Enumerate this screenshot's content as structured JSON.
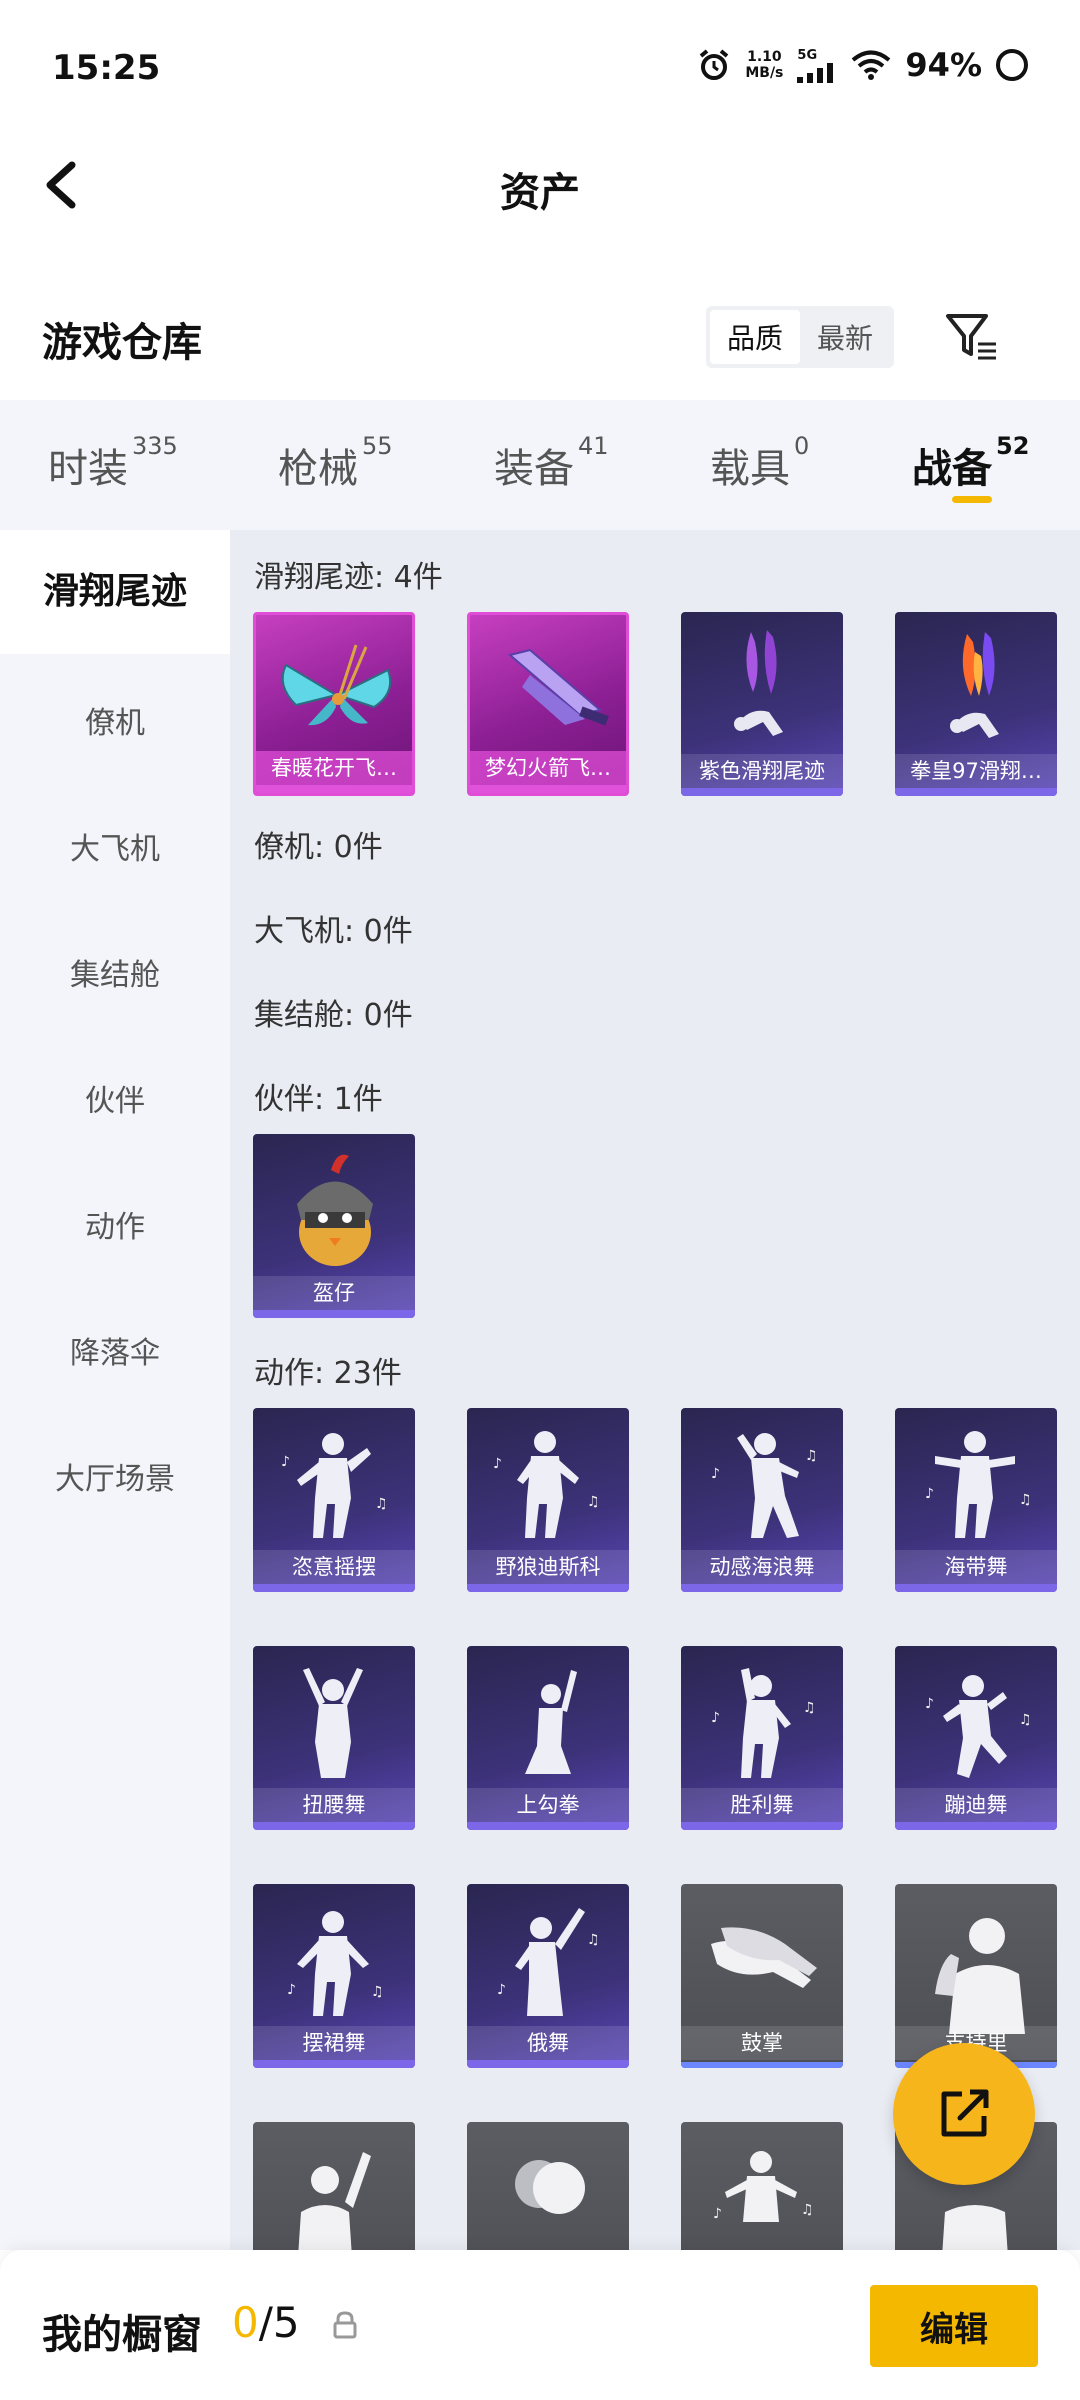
{
  "status_bar": {
    "time": "15:25",
    "net_speed_value": "1.10",
    "net_speed_unit": "MB/s",
    "network": "5G",
    "battery": "94%",
    "icons": [
      "alarm-icon",
      "signal-icon",
      "wifi-icon",
      "battery-icon"
    ]
  },
  "header": {
    "title": "资产",
    "back_icon": "chevron-left-icon"
  },
  "warehouse": {
    "title": "游戏仓库",
    "sort_options": [
      "品质",
      "最新"
    ],
    "sort_active": "品质",
    "filter_icon": "filter-icon"
  },
  "tabs": [
    {
      "label": "时装",
      "count": "335"
    },
    {
      "label": "枪械",
      "count": "55"
    },
    {
      "label": "装备",
      "count": "41"
    },
    {
      "label": "载具",
      "count": "0"
    },
    {
      "label": "战备",
      "count": "52",
      "active": true
    }
  ],
  "side_nav": [
    "滑翔尾迹",
    "僚机",
    "大飞机",
    "集结舱",
    "伙伴",
    "动作",
    "降落伞",
    "大厅场景"
  ],
  "side_nav_active": "滑翔尾迹",
  "sections": {
    "trail": {
      "label": "滑翔尾迹: 4件",
      "items": [
        "春暖花开飞…",
        "梦幻火箭飞…",
        "紫色滑翔尾迹",
        "拳皇97滑翔…"
      ]
    },
    "wingman": {
      "label": "僚机: 0件"
    },
    "plane": {
      "label": "大飞机: 0件"
    },
    "capsule": {
      "label": "集结舱: 0件"
    },
    "partner": {
      "label": "伙伴: 1件",
      "items": [
        "盔仔"
      ]
    },
    "emote": {
      "label": "动作: 23件",
      "items": [
        "恣意摇摆",
        "野狼迪斯科",
        "动感海浪舞",
        "海带舞",
        "扭腰舞",
        "上勾拳",
        "胜利舞",
        "蹦迪舞",
        "摆裙舞",
        "俄舞",
        "鼓掌",
        "支持里"
      ]
    }
  },
  "fab_icon": "share-external-icon",
  "bottom_bar": {
    "title": "我的橱窗",
    "used": "0",
    "total": "/5",
    "lock_icon": "lock-icon",
    "edit_label": "编辑"
  },
  "colors": {
    "accent": "#f5b800",
    "card_pink": "#c63fc0",
    "card_purple": "#3d327a",
    "card_gray": "#55575d"
  }
}
